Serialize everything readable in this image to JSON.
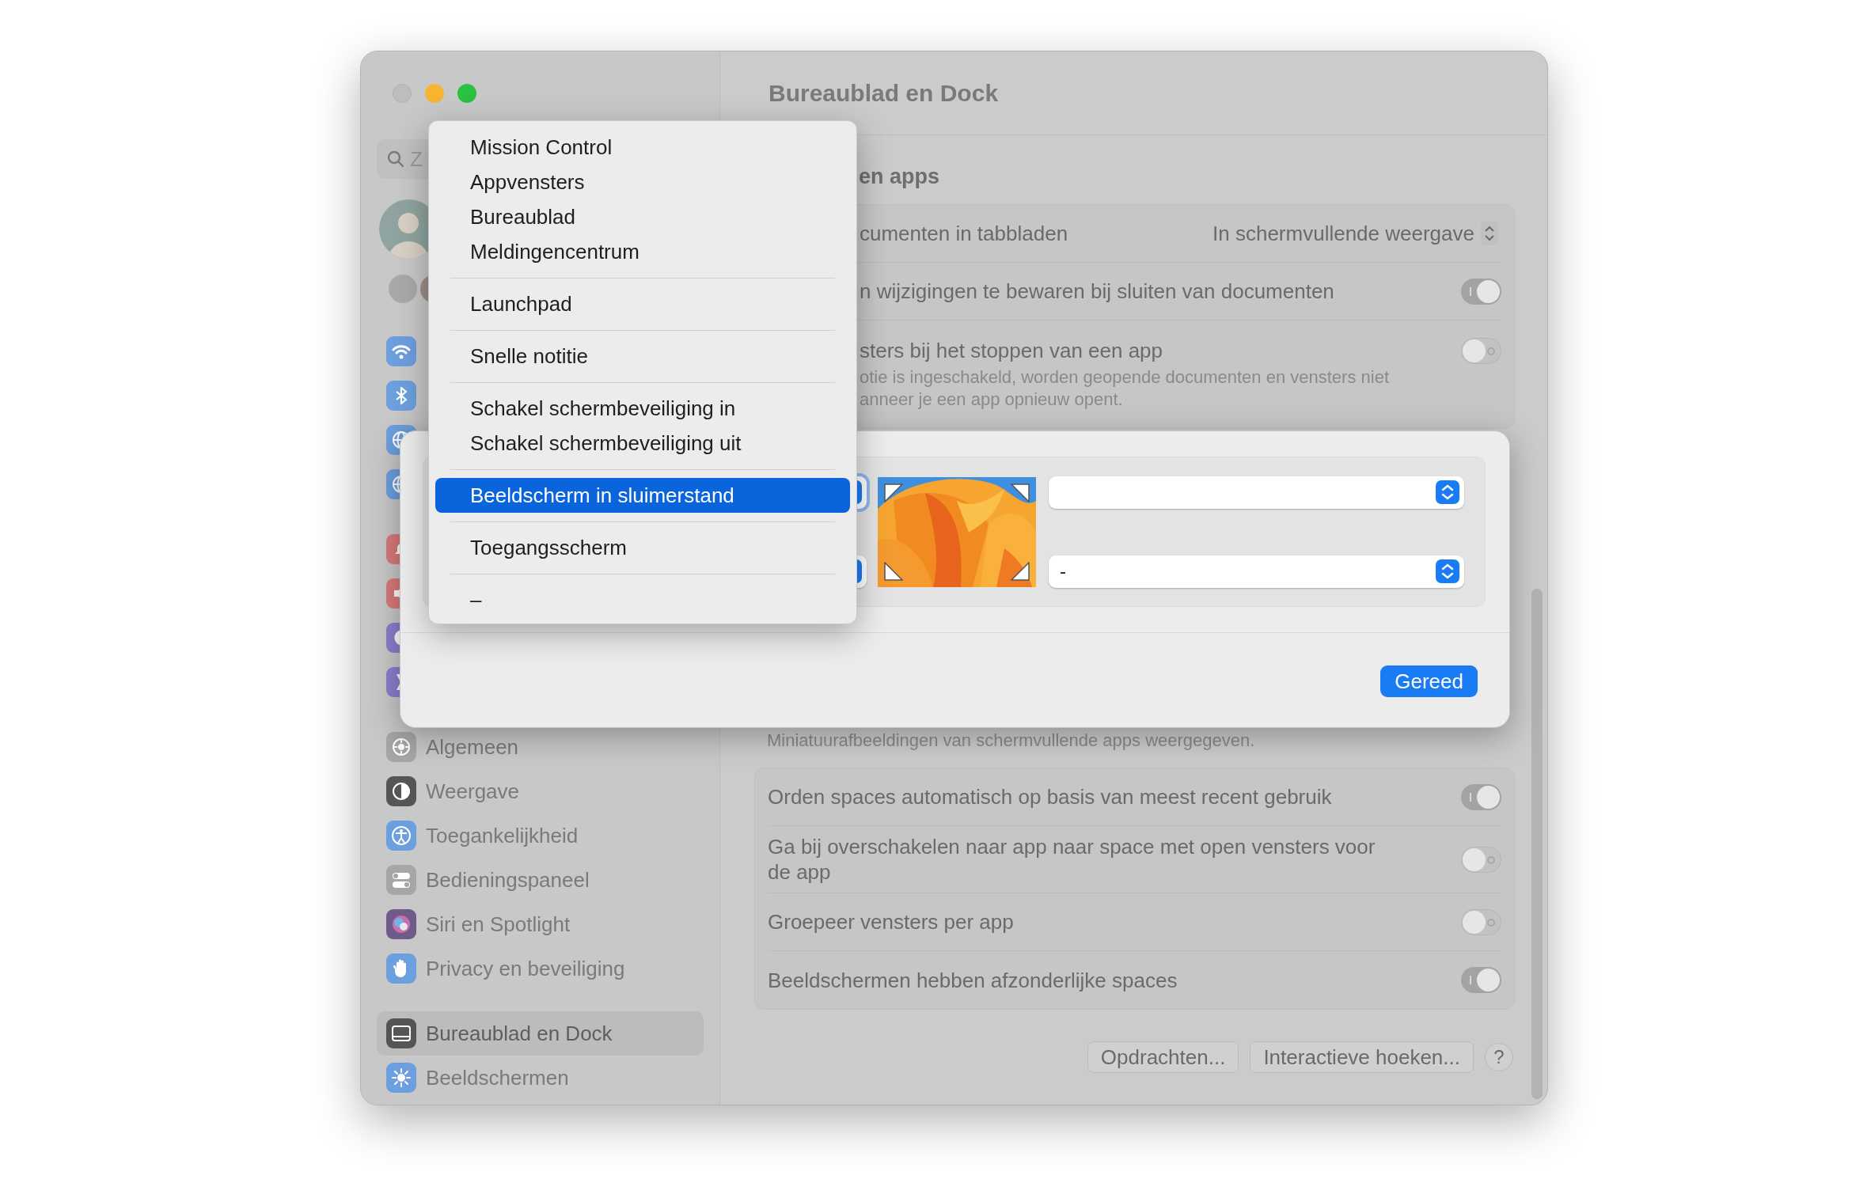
{
  "window": {
    "title": "Bureaublad en Dock"
  },
  "sidebar": {
    "search": {
      "placeholder": "Z"
    },
    "groups": [
      {
        "items": [
          {
            "selected": false
          },
          {
            "selected": false
          },
          {
            "selected": false
          },
          {
            "selected": false
          }
        ]
      },
      {
        "items": [
          {
            "selected": false
          },
          {
            "selected": false
          },
          {
            "selected": false
          },
          {
            "selected": false
          }
        ]
      },
      {
        "items": [
          {
            "label": "Algemeen",
            "selected": false
          },
          {
            "label": "Weergave",
            "selected": false
          },
          {
            "label": "Toegankelijkheid",
            "selected": false
          },
          {
            "label": "Bedieningspaneel",
            "selected": false
          },
          {
            "label": "Siri en Spotlight",
            "selected": false
          },
          {
            "label": "Privacy en beveiliging",
            "selected": false
          }
        ]
      },
      {
        "items": [
          {
            "label": "Bureaublad en Dock",
            "selected": true
          },
          {
            "label": "Beeldschermen",
            "selected": false
          }
        ]
      }
    ]
  },
  "main": {
    "section_title": "en apps",
    "first_group": {
      "rows": [
        {
          "kind": "popup",
          "label": "cumenten in tabbladen",
          "value": "In schermvullende weergave"
        },
        {
          "kind": "toggle",
          "label": "n wijzigingen te bewaren bij sluiten van documenten",
          "on": true
        },
        {
          "kind": "toggle",
          "label": "sters bij het stoppen van een app",
          "on": false,
          "description_lines": [
            "otie is ingeschakeld, worden geopende documenten en vensters niet",
            "anneer je een app opnieuw opent."
          ]
        }
      ]
    },
    "note": "Miniatuurafbeeldingen van schermvullende apps weergegeven.",
    "second_group": {
      "rows": [
        {
          "kind": "toggle",
          "label": "Orden spaces automatisch op basis van meest recent gebruik",
          "on": true
        },
        {
          "kind": "toggle",
          "label": "Ga bij overschakelen naar app naar space met open vensters voor de app",
          "on": false
        },
        {
          "kind": "toggle",
          "label": "Groepeer vensters per app",
          "on": false
        },
        {
          "kind": "toggle",
          "label": "Beeldschermen hebben afzonderlijke spaces",
          "on": true
        }
      ]
    },
    "buttons": [
      "Opdrachten...",
      "Interactieve hoeken...",
      "?"
    ]
  },
  "sheet": {
    "left_popups": [
      {
        "focused": true
      },
      {
        "focused": false
      }
    ],
    "right_popups": [
      {
        "focused": false
      },
      {
        "focused": false,
        "value": "-"
      }
    ],
    "done_button": "Gereed"
  },
  "menu": {
    "sections": [
      [
        {
          "label": "Mission Control",
          "selected": false
        },
        {
          "label": "Appvensters",
          "selected": false
        },
        {
          "label": "Bureaublad",
          "selected": false
        },
        {
          "label": "Meldingencentrum",
          "selected": false
        }
      ],
      [
        {
          "label": "Launchpad",
          "selected": false
        }
      ],
      [
        {
          "label": "Snelle notitie",
          "selected": false
        }
      ],
      [
        {
          "label": "Schakel schermbeveiliging in",
          "selected": false
        },
        {
          "label": "Schakel schermbeveiliging uit",
          "selected": false
        }
      ],
      [
        {
          "label": "Beeldscherm in sluimerstand",
          "selected": true
        }
      ],
      [
        {
          "label": "Toegangsscherm",
          "selected": false
        }
      ],
      [
        {
          "label": "–",
          "selected": false
        }
      ]
    ]
  }
}
